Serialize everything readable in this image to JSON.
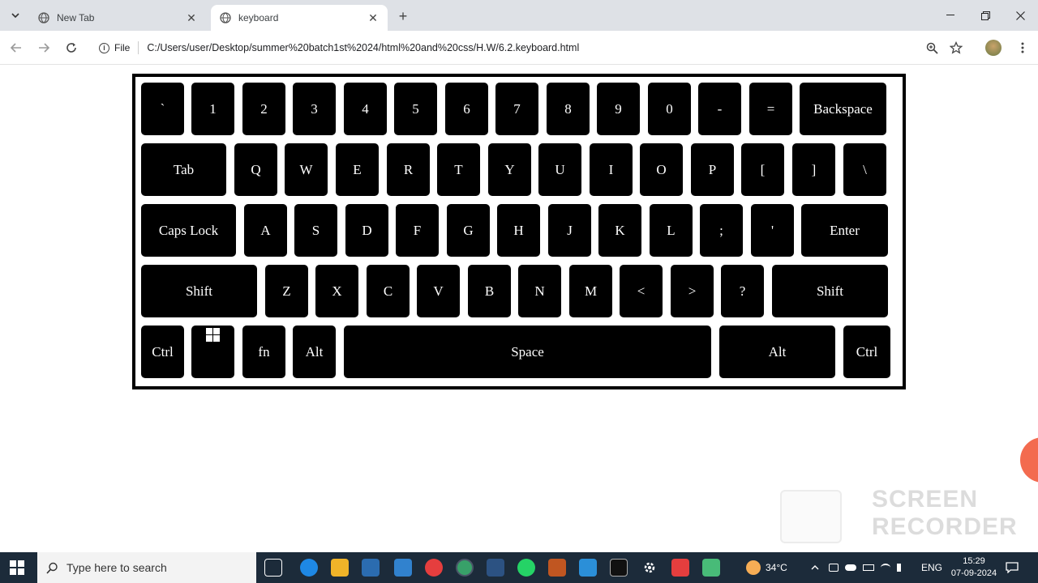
{
  "browser": {
    "tabs": [
      {
        "title": "New Tab",
        "active": false
      },
      {
        "title": "keyboard",
        "active": true
      }
    ],
    "new_tab_symbol": "+",
    "address": {
      "scheme_label": "File",
      "url": "C:/Users/user/Desktop/summer%20batch1st%2024/html%20and%20css/H.W/6.2.keyboard.html"
    }
  },
  "keyboard": {
    "rows": [
      [
        "`",
        "1",
        "2",
        "3",
        "4",
        "5",
        "6",
        "7",
        "8",
        "9",
        "0",
        "-",
        "=",
        "Backspace"
      ],
      [
        "Tab",
        "Q",
        "W",
        "E",
        "R",
        "T",
        "Y",
        "U",
        "I",
        "O",
        "P",
        "[",
        "]",
        "\\"
      ],
      [
        "Caps Lock",
        "A",
        "S",
        "D",
        "F",
        "G",
        "H",
        "J",
        "K",
        "L",
        ";",
        "'",
        "Enter"
      ],
      [
        "Shift",
        "Z",
        "X",
        "C",
        "V",
        "B",
        "N",
        "M",
        "<",
        ">",
        "?",
        "Shift"
      ],
      [
        "Ctrl",
        "",
        "fn",
        "Alt",
        "Space",
        "Alt",
        "Ctrl"
      ]
    ]
  },
  "overlay": {
    "recorder_text": "SCREEN RECORDER"
  },
  "taskbar": {
    "search_placeholder": "Type here to search",
    "weather": "34°C",
    "language": "ENG",
    "time": "15:29",
    "date": "07-09-2024"
  },
  "icons": {
    "tab_list": "chevron-down-icon",
    "tab_favicon": "globe-icon",
    "back": "back-arrow-icon",
    "forward": "forward-arrow-icon",
    "reload": "reload-icon",
    "info": "info-icon",
    "zoom": "zoom-icon",
    "bookmark": "star-icon",
    "menu": "kebab-icon",
    "windows_key": "windows-logo-icon"
  },
  "colors": {
    "key_background": "#000000",
    "key_text": "#ffffff",
    "tabbar": "#dee1e6",
    "taskbar": "#1c2b3a"
  }
}
